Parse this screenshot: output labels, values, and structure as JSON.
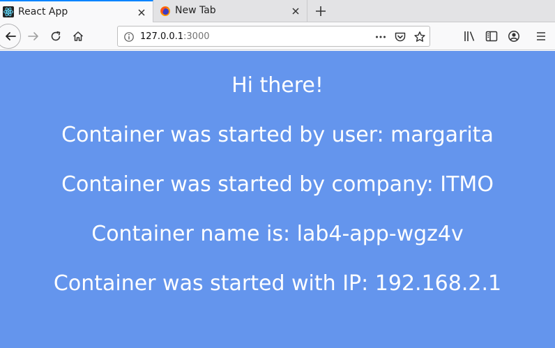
{
  "browser": {
    "tabs": [
      {
        "title": "React App",
        "active": true
      },
      {
        "title": "New Tab",
        "active": false
      }
    ],
    "url": {
      "host": "127.0.0.1",
      "port": ":3000"
    },
    "accent_color": "#0a84ff"
  },
  "page": {
    "background_color": "#6495ed",
    "lines": [
      "Hi there!",
      "Container was started by user: margarita",
      "Container was started by company: ITMO",
      "Container name is: lab4-app-wgz4v",
      "Container was started with IP: 192.168.2.1"
    ]
  }
}
